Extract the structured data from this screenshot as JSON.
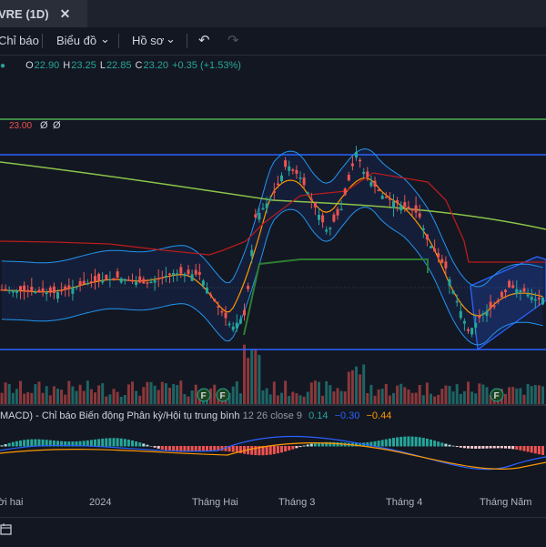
{
  "tab": {
    "title": "VRE (1D)",
    "close": "✕"
  },
  "toolbar": {
    "indicators": "Chỉ báo",
    "chart_type": "Biểu đồ",
    "profile": "Hồ sơ",
    "chevron": "⌄",
    "undo": "↶",
    "redo": "↷"
  },
  "ohlc": {
    "o_label": "O",
    "o": "22.90",
    "h_label": "H",
    "h": "23.25",
    "l_label": "L",
    "l": "22.85",
    "c_label": "C",
    "c": "23.20",
    "change": "+0.35 (+1.53%)",
    "bullet": "●"
  },
  "alert": {
    "price": "23.00",
    "eye1": "Ø",
    "eye2": "Ø"
  },
  "earnings_marker": "F",
  "macd": {
    "label": "MACD) - Chỉ báo Biến động Phân kỳ/Hội tụ trung bình",
    "params": "12 26 close 9",
    "v1": "0.14",
    "v2": "−0.30",
    "v3": "−0.44"
  },
  "time_axis": {
    "labels": [
      "ời hai",
      "2024",
      "Tháng Hai",
      "Tháng 3",
      "Tháng 4",
      "Tháng Năm"
    ]
  },
  "colors": {
    "up": "#26a69a",
    "down": "#ef5350",
    "bg": "#131722"
  }
}
